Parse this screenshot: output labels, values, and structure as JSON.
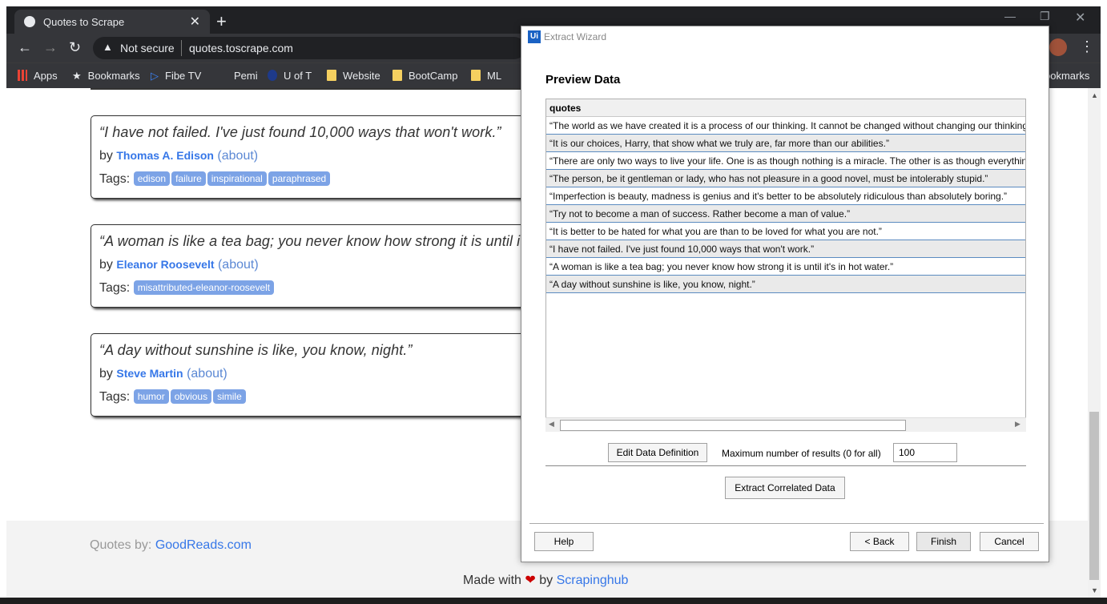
{
  "browser": {
    "tab_title": "Quotes to Scrape",
    "omnibox": {
      "security": "Not secure",
      "url": "quotes.toscrape.com"
    },
    "bookmarks": [
      "Apps",
      "Bookmarks",
      "Fibe TV",
      "Pemi",
      "U of T",
      "Website",
      "BootCamp",
      "ML",
      "ookmarks"
    ]
  },
  "quotes": [
    {
      "text": "“I have not failed. I've just found 10,000 ways that won't work.”",
      "by": "by",
      "author": "Thomas A. Edison",
      "about": "(about)",
      "tags_label": "Tags:",
      "tags": [
        "edison",
        "failure",
        "inspirational",
        "paraphrased"
      ]
    },
    {
      "text": "“A woman is like a tea bag; you never know how strong it is until it",
      "by": "by",
      "author": "Eleanor Roosevelt",
      "about": "(about)",
      "tags_label": "Tags:",
      "tags": [
        "misattributed-eleanor-roosevelt"
      ]
    },
    {
      "text": "“A day without sunshine is like, you know, night.”",
      "by": "by",
      "author": "Steve Martin",
      "about": "(about)",
      "tags_label": "Tags:",
      "tags": [
        "humor",
        "obvious",
        "simile"
      ]
    }
  ],
  "footer": {
    "quotes_by": "Quotes by:",
    "goodreads": "GoodReads.com",
    "made_with": "Made with",
    "heart": "❤",
    "by": "by",
    "scrapinghub": "Scrapinghub"
  },
  "wizard": {
    "title": "Extract Wizard",
    "logo": "Ui",
    "heading": "Preview Data",
    "column": "quotes",
    "rows": [
      "“The world as we have created it is a process of our thinking. It cannot be changed without changing our thinking",
      "“It is our choices, Harry, that show what we truly are, far more than our abilities.”",
      "“There are only two ways to live your life. One is as though nothing is a miracle. The other is as though everything",
      "“The person, be it gentleman or lady, who has not pleasure in a good novel, must be intolerably stupid.”",
      "“Imperfection is beauty, madness is genius and it's better to be absolutely ridiculous than absolutely boring.”",
      "“Try not to become a man of success. Rather become a man of value.”",
      "“It is better to be hated for what you are than to be loved for what you are not.”",
      "“I have not failed. I've just found 10,000 ways that won't work.”",
      "“A woman is like a tea bag; you never know how strong it is until it's in hot water.”",
      "“A day without sunshine is like, you know, night.”"
    ],
    "edit_button": "Edit Data Definition",
    "max_label": "Maximum number of results (0 for all)",
    "max_value": "100",
    "correlated_button": "Extract Correlated Data",
    "help_button": "Help",
    "back_button": "< Back",
    "finish_button": "Finish",
    "cancel_button": "Cancel"
  }
}
